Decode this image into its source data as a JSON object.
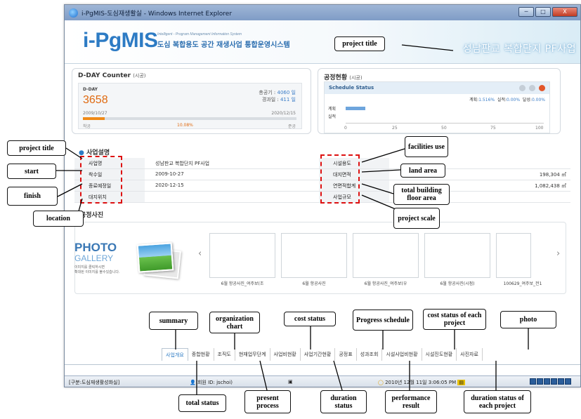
{
  "window": {
    "title": "i-PgMIS-도심재생활실 - Windows Internet Explorer",
    "buttons": [
      "─",
      "□",
      "X"
    ]
  },
  "header": {
    "logo": "i-PgMIS",
    "subtitle_en": "Intelligent - Program Management Information System",
    "subtitle_ko": "도심 복합용도 공간 재생사업 통합운영시스템",
    "project_banner": "성남판교 복합단지 PF사업"
  },
  "dday": {
    "title": "D-DAY Counter",
    "title_suffix": "(시공)",
    "label": "D-DAY",
    "value": "3658",
    "total_label": "총공기 :",
    "total_value": "4060 일",
    "elapsed_label": "경과일 :",
    "elapsed_value": "411 일",
    "start_date": "2009/10/27",
    "end_date": "2020/12/15",
    "start_label": "착공",
    "percent": "10.08%",
    "end_label": "준공",
    "progress": 0.1008
  },
  "schedule": {
    "title": "공정현황",
    "title_suffix": "(시공)",
    "header": "Schedule Status",
    "plan_label": "계획:",
    "plan_value": "1.516%",
    "actual_label": "실적:",
    "actual_value": "0.00%",
    "achieve_label": "달성:",
    "achieve_value": "0.00%",
    "row_plan": "계획",
    "row_actual": "실적",
    "ticks": [
      "0",
      "25",
      "50",
      "75",
      "100"
    ],
    "plan_progress": 0.1
  },
  "summary": {
    "section_title": "사업설명",
    "rows": [
      {
        "label": "사업명",
        "value": "성남판교 복합단지 PF사업",
        "rlabel": "시설용도",
        "rvalue": ""
      },
      {
        "label": "착수일",
        "value": "2009-10-27",
        "rlabel": "대지면적",
        "rvalue": "198,304 ㎡"
      },
      {
        "label": "종료예정일",
        "value": "2020-12-15",
        "rlabel": "연면적합계",
        "rvalue": "1,082,438 ㎡"
      },
      {
        "label": "대지위치",
        "value": "",
        "rlabel": "사업규모",
        "rvalue": ""
      }
    ]
  },
  "gallery": {
    "section_title": "공정사진",
    "title": "PHOTO",
    "subtitle": "GALLERY",
    "note1": "이미지를 클릭하시면",
    "note2": "확대된 이미지를 볼수있습니다.",
    "prev": "‹",
    "next": "›",
    "captions": [
      "6월 항공사진_여주보(조",
      "6월 항공사진",
      "6월 항공사진_여주보(우",
      "6월 항공사진(시점)",
      "100629_여주보_전1"
    ]
  },
  "tabs": [
    "사업개요",
    "종합현황",
    "조직도",
    "현재업무단계",
    "사업비현황",
    "사업기간현황",
    "공정표",
    "성과조회",
    "시설사업비현황",
    "시설진도현황",
    "사진자료"
  ],
  "statusbar": {
    "left": "[구분:도심재생활성화실]",
    "user_label": "회원",
    "user_id": "ID: jschoi)",
    "datetime": "2010년 12월 11일 3:06:05 PM"
  },
  "callouts": {
    "project_title_top": "project title",
    "project_title_left": "project title",
    "start": "start",
    "finish": "finish",
    "location": "location",
    "facilities_use": "facilities use",
    "land_area": "land area",
    "total_floor": "total building floor area",
    "project_scale": "project scale",
    "summary": "summary",
    "org_chart": "organization chart",
    "cost_status": "cost status",
    "progress_schedule": "Progress schedule",
    "cost_each": "cost status of each project",
    "photo": "photo",
    "total_status": "total status",
    "present_process": "present process",
    "duration_status": "duration status",
    "performance_result": "performance result",
    "duration_each": "duration status of each project"
  }
}
